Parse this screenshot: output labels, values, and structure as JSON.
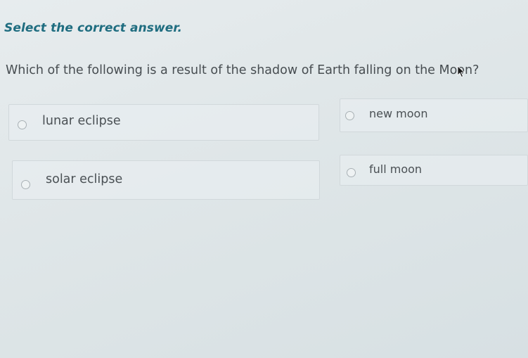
{
  "instruction": "Select the correct answer.",
  "question": "Which of the following is a result of the shadow of Earth falling on the Moon?",
  "options": [
    {
      "label": "lunar eclipse"
    },
    {
      "label": "new moon"
    },
    {
      "label": "solar eclipse"
    },
    {
      "label": "full moon"
    }
  ],
  "colors": {
    "instruction": "#1f6d80",
    "background": "#e2e8ea",
    "radio_border": "#a9b1b5"
  },
  "icons": {
    "radio": "radio-unselected-icon",
    "cursor": "mouse-pointer-icon"
  }
}
